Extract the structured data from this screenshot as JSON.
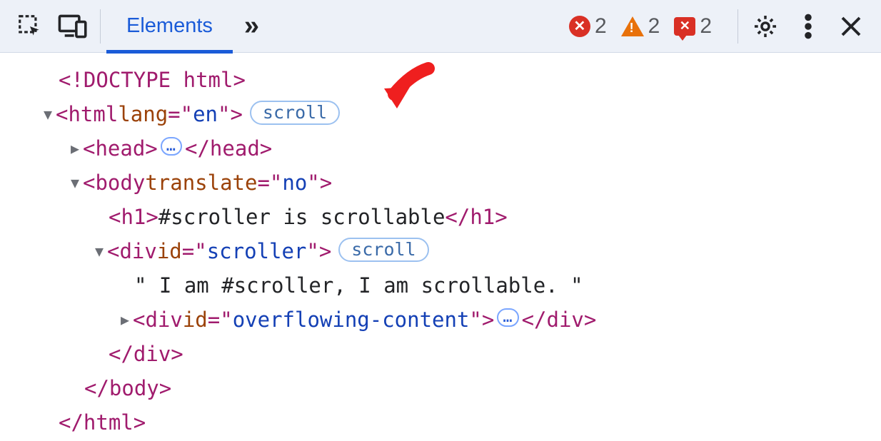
{
  "toolbar": {
    "tabs": {
      "elements": "Elements"
    },
    "counts": {
      "errors": "2",
      "warnings": "2",
      "issues": "2"
    }
  },
  "badges": {
    "scroll": "scroll"
  },
  "tree": {
    "doctype_open": "<!DOCTYPE ",
    "doctype_name": "html",
    "doctype_close": ">",
    "html_open1": "<html ",
    "html_lang_name": "lang",
    "html_eq": "=\"",
    "html_lang_val": "en",
    "html_close_attr": "\">",
    "head_open": "<head>",
    "head_close": "</head>",
    "body_open1": "<body ",
    "body_attr_name": "translate",
    "body_attr_val": "no",
    "h1_open": "<h1>",
    "h1_text": "#scroller is scrollable",
    "h1_close": "</h1>",
    "div1_open1": "<div ",
    "div1_id_name": "id",
    "div1_id_val": "scroller",
    "div1_close_attr": "\">",
    "text_node": "\" I am #scroller, I am scrollable. \"",
    "div2_open1": "<div ",
    "div2_id_name": "id",
    "div2_id_val": "overflowing-content",
    "div_close": "</div>",
    "body_close": "</body>",
    "html_close": "</html>",
    "ellipsis": "…"
  }
}
